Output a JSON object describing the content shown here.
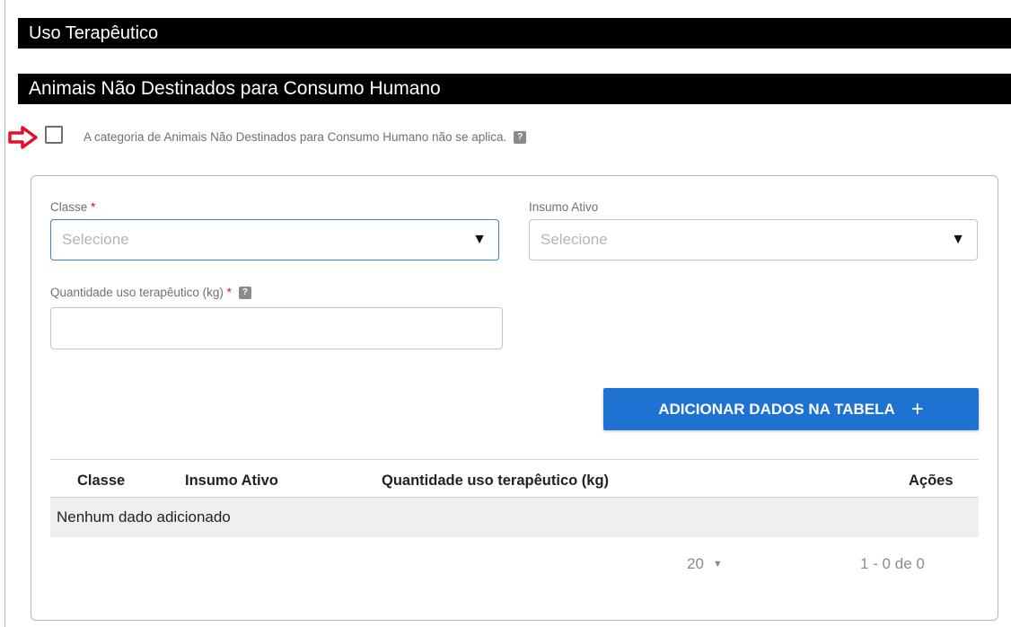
{
  "section_title": "Uso Terapêutico",
  "subsection_title": "Animais Não Destinados para Consumo Humano",
  "not_applicable": {
    "label": "A categoria de Animais Não Destinados para Consumo Humano não se aplica.",
    "checked": false,
    "help_icon": "?"
  },
  "form": {
    "classe": {
      "label": "Classe",
      "required_mark": "*",
      "placeholder": "Selecione",
      "caret": "▼"
    },
    "insumo_ativo": {
      "label": "Insumo Ativo",
      "placeholder": "Selecione",
      "caret": "▼"
    },
    "quantidade": {
      "label": "Quantidade uso terapêutico (kg)",
      "required_mark": "*",
      "help_icon": "?",
      "value": ""
    }
  },
  "add_button": {
    "label": "ADICIONAR DADOS NA TABELA",
    "icon": "+"
  },
  "table": {
    "headers": [
      "Classe",
      "Insumo Ativo",
      "Quantidade uso terapêutico (kg)",
      "Ações"
    ],
    "empty_message": "Nenhum dado adicionado",
    "page_size": "20",
    "page_size_caret": "▼",
    "range": "1 - 0 de 0"
  },
  "colors": {
    "header_bar": "#000000",
    "primary_button": "#1e73d2",
    "required": "#e0112b",
    "arrow": "#e0112b",
    "focus_border": "#3e7fd4"
  }
}
